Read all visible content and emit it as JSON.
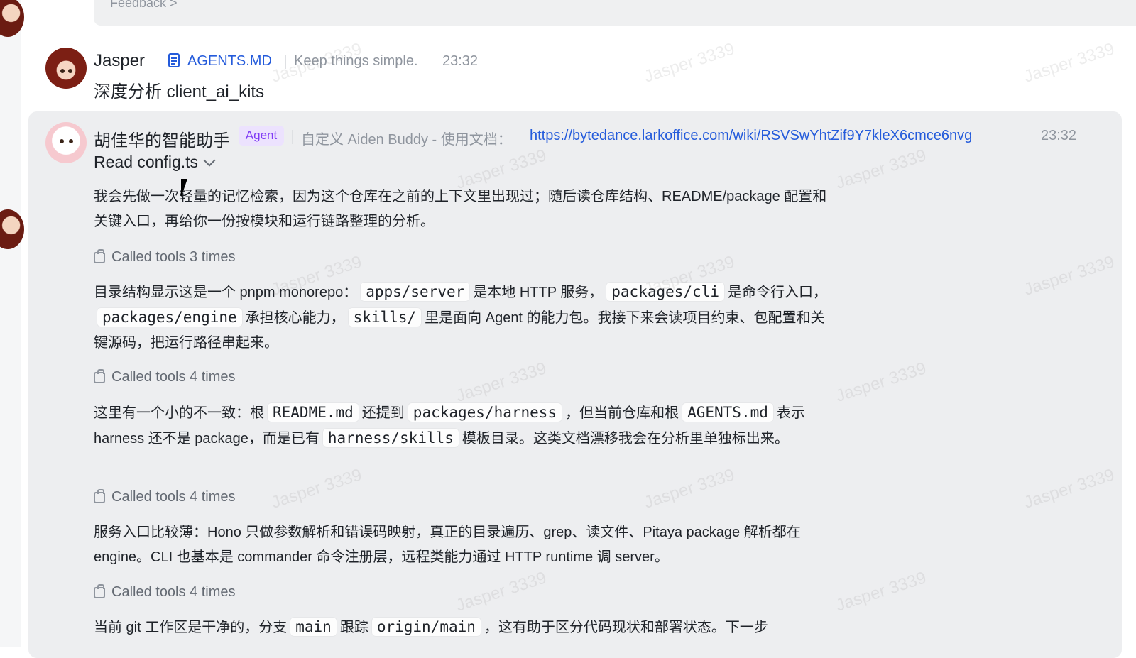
{
  "top": {
    "feedback_label": "Feedback >"
  },
  "jasper_message": {
    "sender": "Jasper",
    "doc_link": "AGENTS.MD",
    "note": "Keep things simple.",
    "time": "23:32",
    "text": "深度分析 client_ai_kits"
  },
  "agent_message": {
    "sender": "胡佳华的智能助手",
    "badge": "Agent",
    "desc": "自定义 Aiden Buddy - 使用文档：",
    "url": "https://bytedance.larkoffice.com/wiki/RSVSwYhtZif9Y7kleX6cmce6nvg",
    "time": "23:32",
    "read_label": "Read config.ts",
    "p1": "我会先做一次轻量的记忆检索，因为这个仓库在之前的上下文里出现过；随后读仓库结构、README/package 配置和关键入口，再给你一份按模块和运行链路整理的分析。",
    "tools1": "Called tools 3 times",
    "p2": {
      "t1": "目录结构显示这是一个 pnpm monorepo：",
      "c1": "apps/server",
      "t2": "是本地 HTTP 服务，",
      "c2": "packages/cli",
      "t3": "是命令行入口，",
      "c3": "packages/engine",
      "t4": "承担核心能力，",
      "c4": "skills/",
      "t5": "里是面向 Agent 的能力包。我接下来会读项目约束、包配置和关键源码，把运行路径串起来。"
    },
    "tools2": "Called tools 4 times",
    "p3": {
      "t1": "这里有一个小的不一致：根",
      "c1": "README.md",
      "t2": "还提到",
      "c2": "packages/harness",
      "t3": "，但当前仓库和根",
      "c3": "AGENTS.md",
      "t4": "表示 harness 还不是 package，而是已有",
      "c4": "harness/skills",
      "t5": "模板目录。这类文档漂移我会在分析里单独标出来。"
    },
    "tools3": "Called tools 4 times",
    "p4": "服务入口比较薄：Hono 只做参数解析和错误码映射，真正的目录遍历、grep、读文件、Pitaya package 解析都在 engine。CLI 也基本是 commander 命令注册层，远程类能力通过 HTTP runtime 调 server。",
    "tools4": "Called tools 4 times",
    "p5": {
      "t1": "当前 git 工作区是干净的，分支",
      "c1": "main",
      "t2": "跟踪",
      "c2": "origin/main",
      "t3": "，这有助于区分代码现状和部署状态。下一步"
    }
  },
  "watermark": "Jasper 3339"
}
